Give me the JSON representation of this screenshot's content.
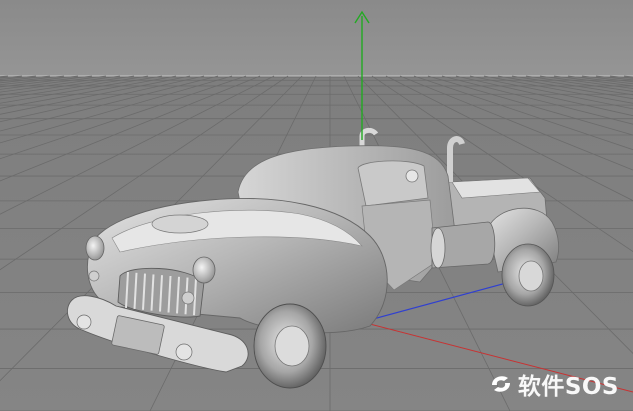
{
  "viewport": {
    "colors": {
      "sky": "#8f8f8f",
      "floor": "#7c7c7c",
      "grid": "#6a6a6a",
      "horizon": "#b8b8b8",
      "axis_y": "#22aa22",
      "axis_x": "#c83232",
      "axis_z": "#3040d0",
      "car_body": "#bdbdbd",
      "car_shadow": "#6e6e6e",
      "car_highlight": "#eeeeee"
    },
    "icons": {
      "axis_y": "axis-arrow-icon",
      "watermark_logo": "sos-logo-icon"
    }
  },
  "watermark": {
    "text": "软件SOS"
  }
}
